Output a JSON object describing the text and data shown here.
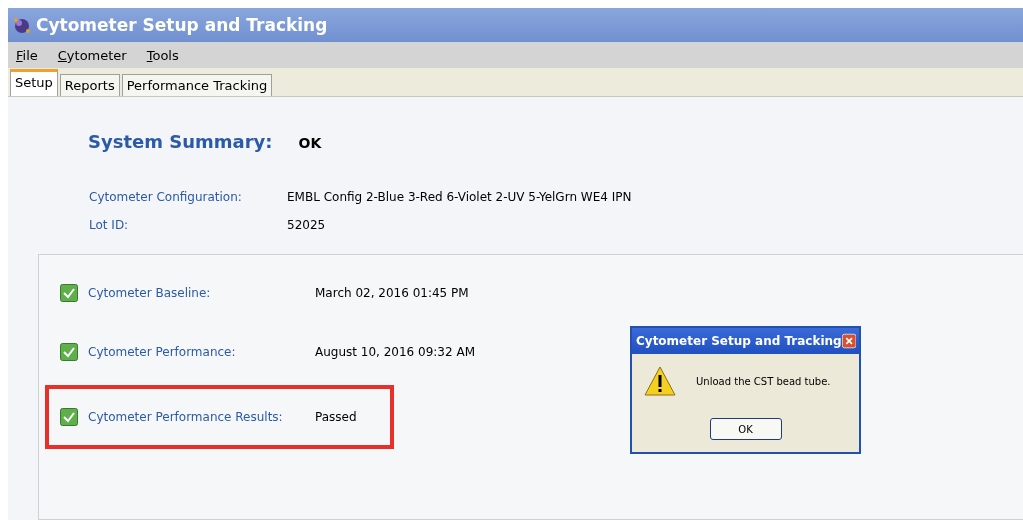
{
  "window": {
    "title": "Cytometer Setup and Tracking"
  },
  "menu": [
    "File",
    "Cytometer",
    "Tools"
  ],
  "tabs": [
    {
      "label": "Setup",
      "selected": true
    },
    {
      "label": "Reports",
      "selected": false
    },
    {
      "label": "Performance Tracking",
      "selected": false
    }
  ],
  "summary": {
    "label": "System Summary:",
    "value": "OK"
  },
  "info": [
    {
      "label": "Cytometer Configuration:",
      "value": "EMBL Config 2-Blue 3-Red 6-Violet 2-UV 5-YelGrn WE4 IPN"
    },
    {
      "label": "Lot ID:",
      "value": "52025"
    }
  ],
  "checks": [
    {
      "label": "Cytometer Baseline:",
      "value": "March 02, 2016 01:45 PM",
      "passed": true,
      "highlighted": false
    },
    {
      "label": "Cytometer Performance:",
      "value": "August 10, 2016 09:32 AM",
      "passed": true,
      "highlighted": false
    },
    {
      "label": "Cytometer Performance Results:",
      "value": "Passed",
      "passed": true,
      "highlighted": true
    }
  ],
  "dialog": {
    "title": "Cytometer Setup and Tracking",
    "message": "Unload the CST bead tube.",
    "button": "OK"
  }
}
